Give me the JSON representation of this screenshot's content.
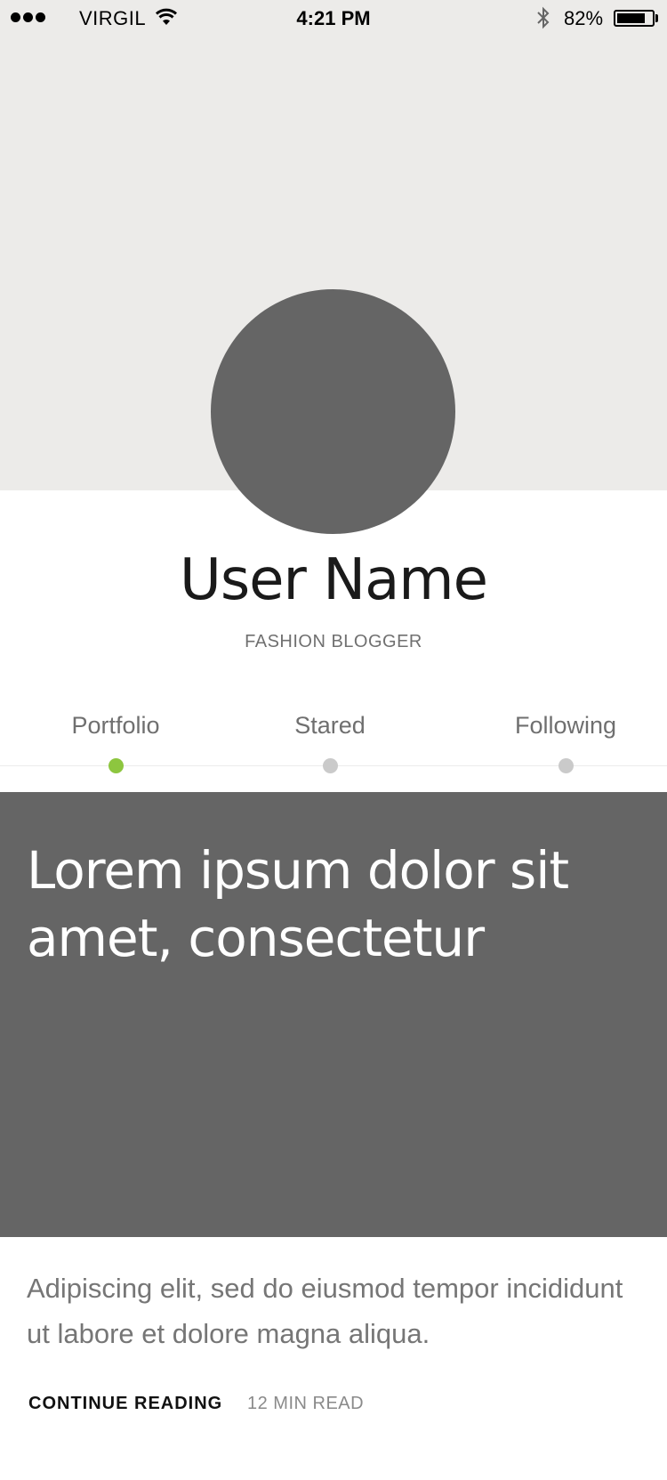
{
  "status_bar": {
    "carrier": "VIRGIL",
    "time": "4:21 PM",
    "battery_percent_text": "82%",
    "battery_level": 0.82,
    "icons": [
      "signal-dots-icon",
      "wifi-icon",
      "bluetooth-icon",
      "battery-icon"
    ]
  },
  "profile": {
    "name": "User Name",
    "role": "FASHION BLOGGER"
  },
  "tabs": [
    {
      "label": "Portfolio",
      "active": true
    },
    {
      "label": "Stared",
      "active": false
    },
    {
      "label": "Following",
      "active": false
    }
  ],
  "colors": {
    "accent": "#8dc63f",
    "inactive_dot": "#cacaca",
    "placeholder": "#656565",
    "cover_bg": "#ecebe9"
  },
  "article": {
    "title": "Lorem ipsum dolor sit amet, consectetur",
    "excerpt": "Adipiscing elit, sed do eiusmod tempor incididunt ut labore et dolore magna aliqua.",
    "cta": "CONTINUE READING",
    "read_time": "12 MIN READ"
  }
}
